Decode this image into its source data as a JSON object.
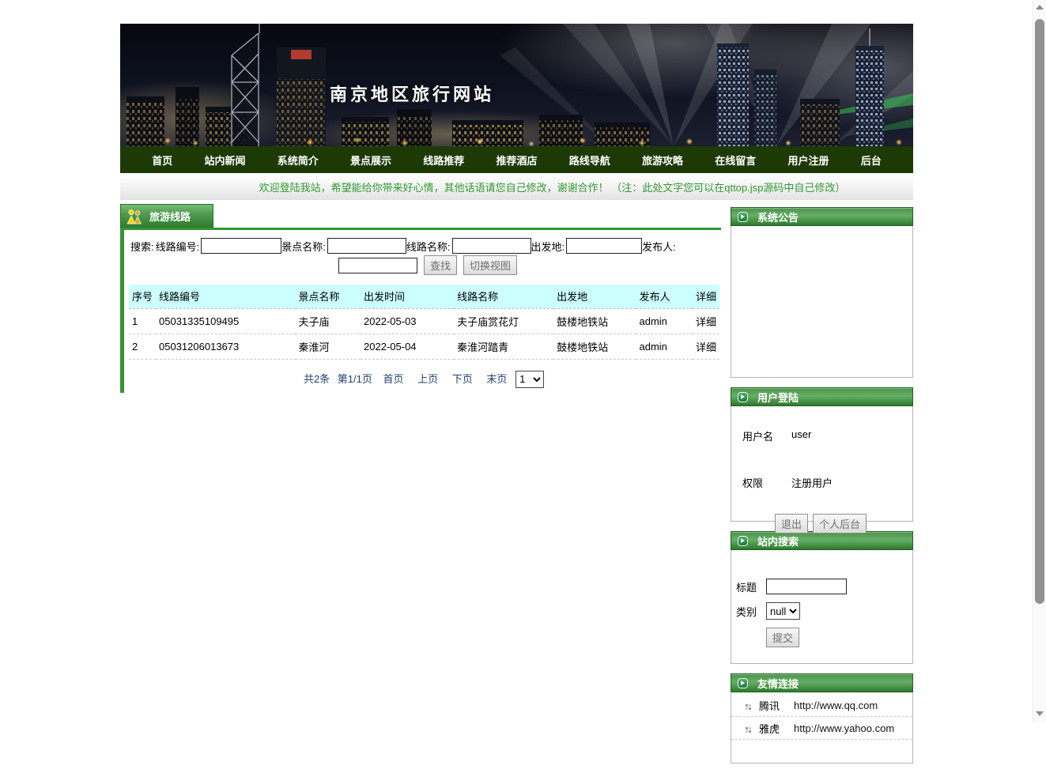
{
  "header": {
    "site_title": "南京地区旅行网站"
  },
  "nav": {
    "items": [
      {
        "label": "首页"
      },
      {
        "label": "站内新闻"
      },
      {
        "label": "系统简介"
      },
      {
        "label": "景点展示"
      },
      {
        "label": "线路推荐"
      },
      {
        "label": "推荐酒店"
      },
      {
        "label": "路线导航"
      },
      {
        "label": "旅游攻略"
      },
      {
        "label": "在线留言"
      },
      {
        "label": "用户注册"
      },
      {
        "label": "后台"
      }
    ]
  },
  "welcome": {
    "text": "欢迎登陆我站，希望能给你带来好心情，其他话语请您自己修改，谢谢合作！ （注：此处文字您可以在qttop.jsp源码中自己修改）"
  },
  "routes": {
    "tab_label": "旅游线路",
    "search": {
      "prefix_label": "搜索:",
      "fields": [
        {
          "label": "线路编号:"
        },
        {
          "label": "景点名称:"
        },
        {
          "label": "线路名称:"
        },
        {
          "label": "出发地:"
        },
        {
          "label": "发布人:"
        }
      ],
      "find_button": "查找",
      "toggle_view_button": "切换视图"
    },
    "table": {
      "headers": [
        "序号",
        "线路编号",
        "景点名称",
        "出发时间",
        "线路名称",
        "出发地",
        "发布人",
        "详细"
      ],
      "rows": [
        {
          "seq": "1",
          "route_no": "05031335109495",
          "spot": "夫子庙",
          "depart_date": "2022-05-03",
          "route_name": "夫子庙赏花灯",
          "depart_place": "鼓楼地铁站",
          "publisher": "admin",
          "detail": "详细"
        },
        {
          "seq": "2",
          "route_no": "05031206013673",
          "spot": "秦淮河",
          "depart_date": "2022-05-04",
          "route_name": "秦淮河踏青",
          "depart_place": "鼓楼地铁站",
          "publisher": "admin",
          "detail": "详细"
        }
      ]
    },
    "pagination": {
      "total": "共2条",
      "page_info": "第1/1页",
      "first": "首页",
      "prev": "上页",
      "next": "下页",
      "last": "末页",
      "page_select_value": "1"
    }
  },
  "sidebar": {
    "announcement": {
      "title": "系统公告"
    },
    "login": {
      "title": "用户登陆",
      "username_label": "用户名",
      "username_value": "user",
      "role_label": "权限",
      "role_value": "注册用户",
      "logout_button": "退出",
      "personal_admin_button": "个人后台"
    },
    "site_search": {
      "title": "站内搜索",
      "title_label": "标题",
      "category_label": "类别",
      "category_value": "null",
      "submit_button": "提交"
    },
    "links": {
      "title": "友情连接",
      "items": [
        {
          "name": "腾讯",
          "url": "http://www.qq.com"
        },
        {
          "name": "雅虎",
          "url": "http://www.yahoo.com"
        }
      ]
    }
  },
  "colors": {
    "accent_green": "#2e7a2e",
    "nav_green": "#1d3a05",
    "table_header_bg": "#ccffff",
    "welcome_text": "#339933",
    "pagination_text": "#24406e"
  }
}
